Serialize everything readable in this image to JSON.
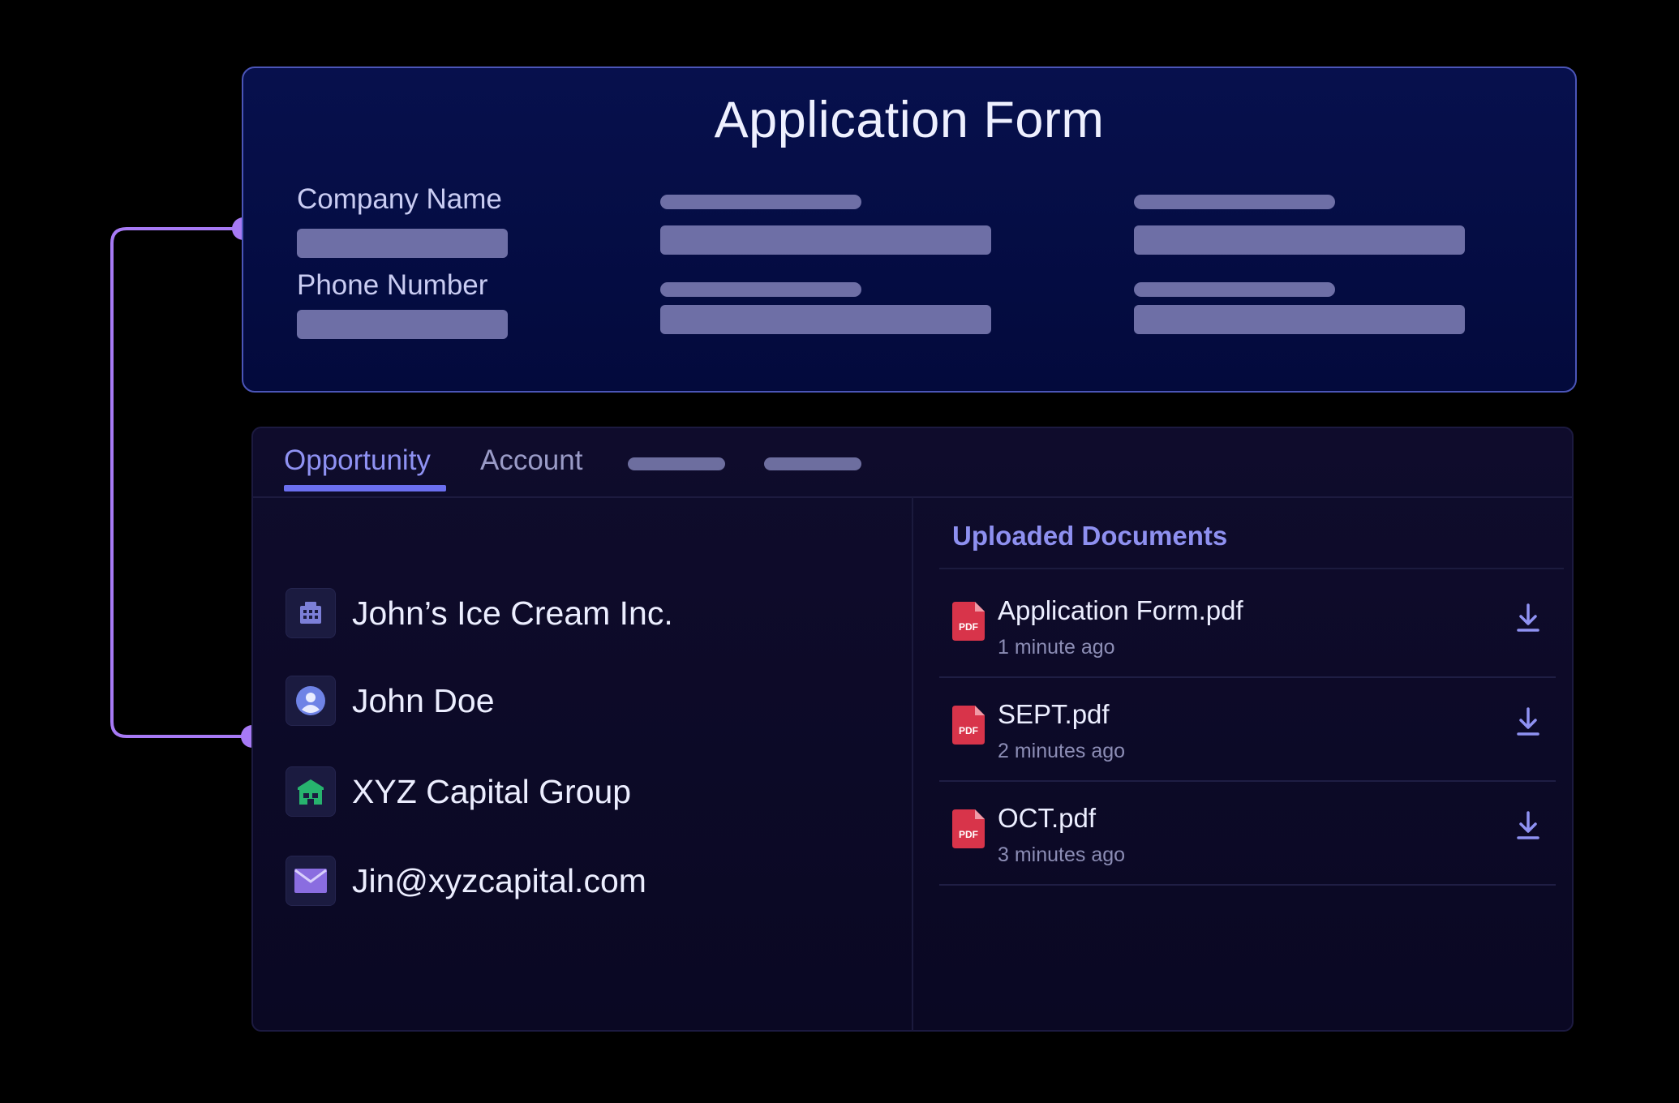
{
  "form": {
    "title": "Application Form",
    "labels": {
      "company_name": "Company Name",
      "phone_number": "Phone Number"
    }
  },
  "tabs": [
    {
      "label": "Opportunity",
      "active": true
    },
    {
      "label": "Account",
      "active": false
    }
  ],
  "info": {
    "company": {
      "text": "John’s Ice Cream Inc.",
      "icon": "building-icon"
    },
    "contact": {
      "text": "John Doe",
      "icon": "user-icon"
    },
    "group": {
      "text": "XYZ Capital Group",
      "icon": "bank-icon"
    },
    "email": {
      "text": "Jin@xyzcapital.com",
      "icon": "mail-icon"
    }
  },
  "documents": {
    "title": "Uploaded Documents",
    "items": [
      {
        "name": "Application Form.pdf",
        "time": "1 minute ago",
        "badge": "PDF"
      },
      {
        "name": "SEPT.pdf",
        "time": "2 minutes ago",
        "badge": "PDF"
      },
      {
        "name": "OCT.pdf",
        "time": "3 minutes ago",
        "badge": "PDF"
      }
    ]
  },
  "colors": {
    "accent": "#8f92f3",
    "connector": "#a77af5",
    "pdf": "#d8344a",
    "placeholder": "#6e6fa6"
  }
}
